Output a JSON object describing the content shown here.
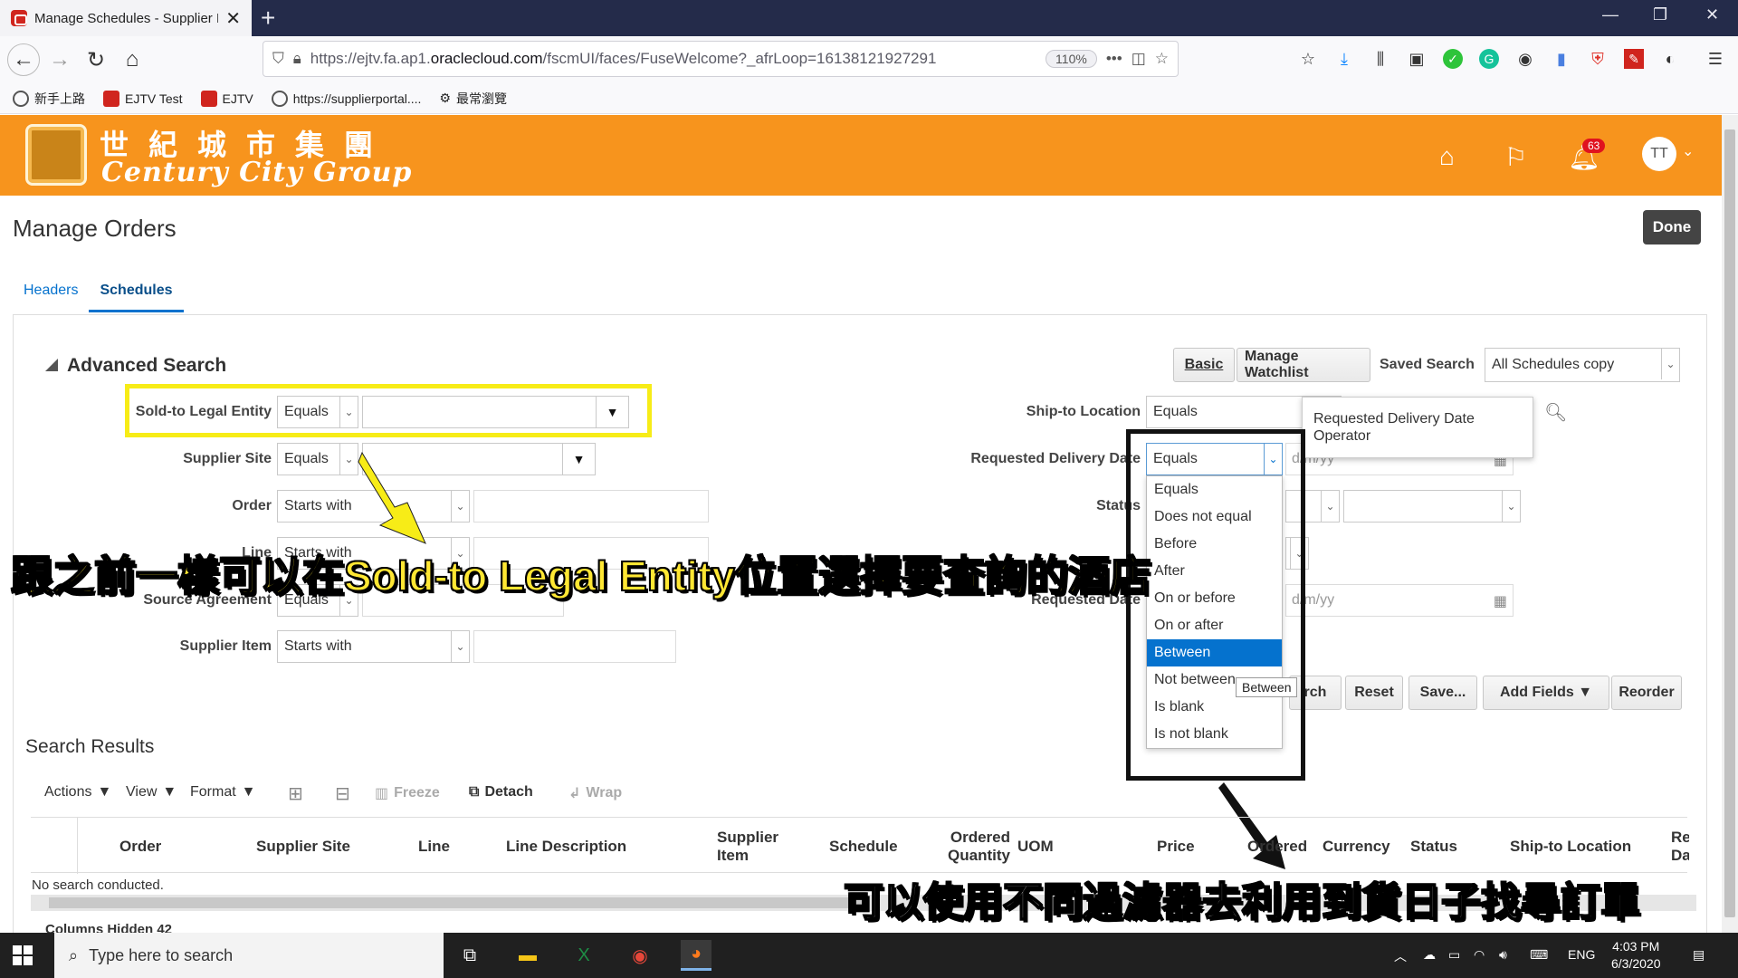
{
  "browser": {
    "tab_title": "Manage Schedules - Supplier P",
    "url_prefix": "https://ejtv.fa.ap1.",
    "url_domain": "oraclecloud.com",
    "url_suffix": "/fscmUI/faces/FuseWelcome?_afrLoop=16138121927291",
    "zoom": "110%",
    "bookmarks": [
      "新手上路",
      "EJTV Test",
      "EJTV",
      "https://supplierportal....",
      "最常瀏覽"
    ]
  },
  "header": {
    "logo_cn": "世紀城市集團",
    "logo_en": "Century City Group",
    "notification_count": "63",
    "avatar_initials": "TT"
  },
  "page": {
    "title": "Manage Orders",
    "done_label": "Done",
    "tabs": [
      {
        "label": "Headers",
        "active": false
      },
      {
        "label": "Schedules",
        "active": true
      }
    ]
  },
  "search": {
    "title": "Advanced Search",
    "buttons": {
      "basic": "Basic",
      "watchlist": "Manage Watchlist",
      "search": "Search",
      "reset": "Reset",
      "save": "Save...",
      "add_fields": "Add Fields",
      "reorder": "Reorder"
    },
    "saved_search_label": "Saved Search",
    "saved_search_value": "All Schedules copy",
    "left_fields": [
      {
        "label": "Sold-to Legal Entity",
        "operator": "Equals"
      },
      {
        "label": "Supplier Site",
        "operator": "Equals"
      },
      {
        "label": "Order",
        "operator": "Starts with"
      },
      {
        "label": "Line",
        "operator": "Starts with"
      },
      {
        "label": "Source Agreement",
        "operator": "Equals"
      },
      {
        "label": "Supplier Item",
        "operator": "Starts with"
      }
    ],
    "right_fields": [
      {
        "label": "Ship-to Location",
        "operator": "Equals"
      },
      {
        "label": "Requested Delivery Date",
        "operator": "Equals",
        "placeholder": "d/m/yy"
      },
      {
        "label": "Status",
        "operator": ""
      },
      {
        "label": "Requested Date",
        "operator": "",
        "placeholder": "d/m/yy"
      }
    ],
    "operator_tooltip": "Requested Delivery Date Operator",
    "operator_options": [
      "Equals",
      "Does not equal",
      "Before",
      "After",
      "On or before",
      "On or after",
      "Between",
      "Not between",
      "Is blank",
      "Is not blank"
    ],
    "selected_option": "Between",
    "hover_tooltip": "Between"
  },
  "results": {
    "title": "Search Results",
    "toolbar": {
      "actions": "Actions",
      "view": "View",
      "format": "Format",
      "freeze": "Freeze",
      "detach": "Detach",
      "wrap": "Wrap"
    },
    "columns": [
      "Order",
      "Supplier Site",
      "Line",
      "Line Description",
      "Supplier Item",
      "Schedule",
      "Ordered Quantity",
      "UOM",
      "Price",
      "Ordered",
      "Currency",
      "Status",
      "Ship-to Location",
      "Re Da"
    ],
    "empty_text": "No search conducted.",
    "hidden_columns": "Columns Hidden  42"
  },
  "captions": {
    "top": "跟之前一樣可以在Sold-to Legal Entity位置選擇要查詢的酒店",
    "bottom": "可以使用不同過濾器去利用到貨日子找尋訂單"
  },
  "taskbar": {
    "search_placeholder": "Type here to search",
    "lang": "ENG",
    "time": "4:03 PM",
    "date": "6/3/2020"
  },
  "colors": {
    "brand_orange": "#f7941d",
    "highlight_yellow": "#f7ec17",
    "selection_blue": "#0572ce"
  }
}
